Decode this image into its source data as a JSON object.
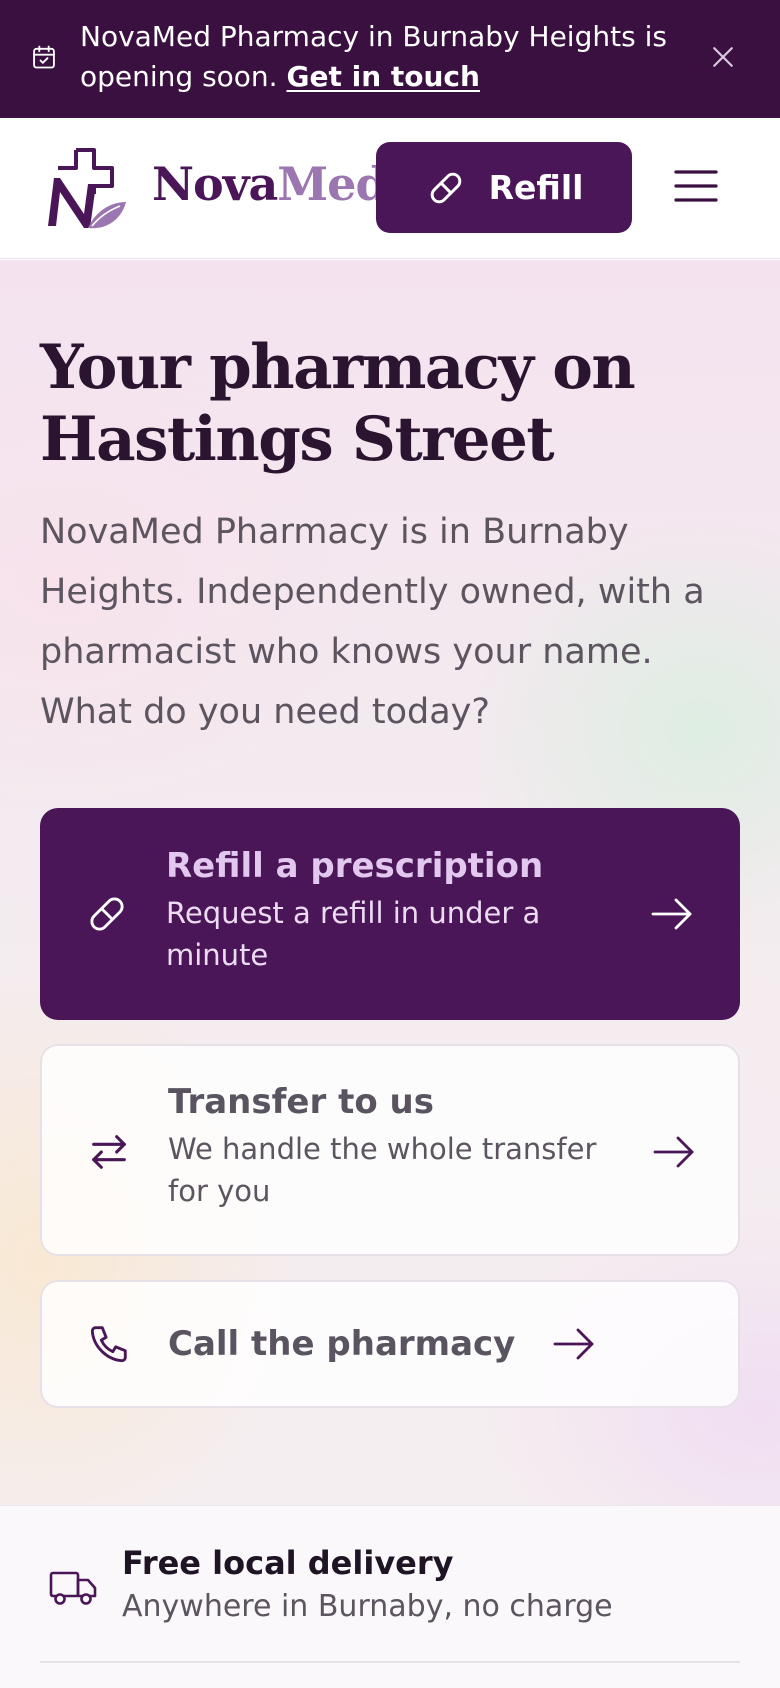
{
  "announcement": {
    "message": "NovaMed Pharmacy in Burnaby Heights is opening soon.",
    "link": "Get in touch",
    "icon": "calendar-icon",
    "close_icon": "close-icon"
  },
  "header": {
    "logo": {
      "part1": "Nova",
      "part2": "Med"
    },
    "refill_button": "Refill",
    "menu_icon": "hamburger-menu-icon"
  },
  "hero": {
    "title_line1": "Your pharmacy on",
    "title_line2": "Hastings Street",
    "lead": "NovaMed Pharmacy is in Burnaby Heights. Independently owned, with a pharmacist who knows your name. What do you need today?"
  },
  "actions": [
    {
      "title": "Refill a prescription",
      "subtitle": "Request a refill in under a minute",
      "icon": "pill-icon"
    },
    {
      "title": "Transfer to us",
      "subtitle": "We handle the whole transfer for you",
      "icon": "transfer-arrows-icon"
    },
    {
      "title": "Call the pharmacy",
      "icon": "phone-icon"
    }
  ],
  "features": [
    {
      "title": "Free local delivery",
      "subtitle": "Anywhere in Burnaby, no charge",
      "icon": "delivery-truck-icon"
    }
  ],
  "colors": {
    "brand_dark": "#4a1657",
    "brand_light": "#9b76b0",
    "banner_bg": "#3a1040"
  }
}
